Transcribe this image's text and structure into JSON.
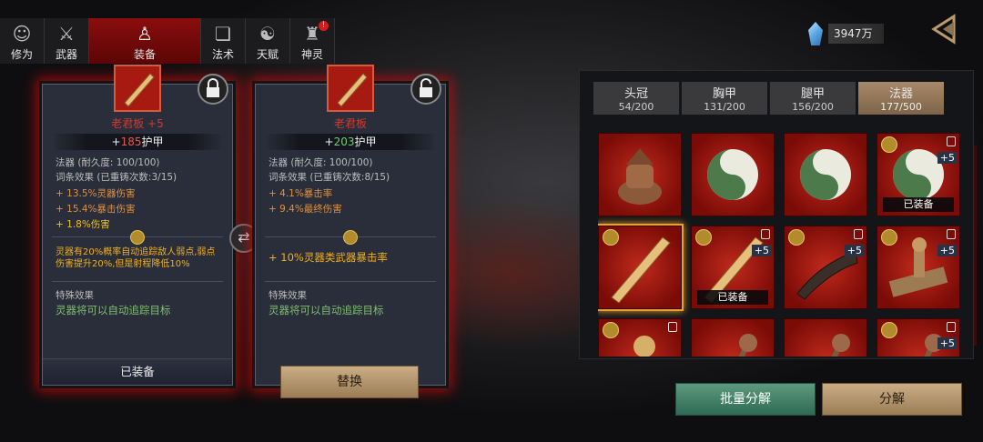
{
  "tabs": [
    {
      "label": "修为",
      "icon": "bust-icon"
    },
    {
      "label": "武器",
      "icon": "sword-icon"
    },
    {
      "label": "装备",
      "icon": "robe-icon"
    },
    {
      "label": "法术",
      "icon": "scroll-icon"
    },
    {
      "label": "天赋",
      "icon": "taiji-icon"
    },
    {
      "label": "神灵",
      "icon": "totem-icon",
      "badge": "!"
    }
  ],
  "currency": {
    "value": "3947万",
    "icon": "crystal-icon"
  },
  "left_card": {
    "name": "老君板 +5",
    "armor_value": "185",
    "armor_prefix": "+",
    "armor_suffix": "护甲",
    "durability": "法器 (耐久度: 100/100)",
    "affix_header": "词条效果 (已重铸次数:3/15)",
    "affixes": [
      "+ 13.5%灵器伤害",
      "+ 15.4%暴击伤害",
      "+ 1.8%伤害"
    ],
    "bonus": "灵器有20%概率自动追踪敌人弱点,弱点伤害提升20%,但是射程降低10%",
    "special_title": "特殊效果",
    "special_text": "灵器将可以自动追踪目标",
    "status": "已装备"
  },
  "right_card": {
    "name": "老君板",
    "armor_value": "203",
    "armor_prefix": "+",
    "armor_suffix": "护甲",
    "durability": "法器 (耐久度: 100/100)",
    "affix_header": "词条效果 (已重铸次数:8/15)",
    "affixes": [
      "+ 4.1%暴击率",
      "+ 9.4%最终伤害"
    ],
    "bonus": "+ 10%灵器类武器暴击率",
    "special_title": "特殊效果",
    "special_text": "灵器将可以自动追踪目标",
    "button": "替换"
  },
  "inventory": {
    "tabs": [
      {
        "label": "头冠",
        "count": "54/200"
      },
      {
        "label": "胸甲",
        "count": "131/200"
      },
      {
        "label": "腿甲",
        "count": "156/200"
      },
      {
        "label": "法器",
        "count": "177/500"
      }
    ],
    "equipped_label": "已装备",
    "plus_label": "+5",
    "items": [
      {
        "icon": "incense-burner-icon"
      },
      {
        "icon": "yin-yang-icon"
      },
      {
        "icon": "yin-yang-icon"
      },
      {
        "icon": "yin-yang-icon",
        "coin": true,
        "lock": true,
        "plus": true,
        "equipped": true
      },
      {
        "icon": "wooden-tablet-icon",
        "coin": true,
        "selected": true
      },
      {
        "icon": "wooden-tablet-icon",
        "coin": true,
        "lock": true,
        "plus": true,
        "equipped": true
      },
      {
        "icon": "horn-icon",
        "coin": true,
        "lock": true,
        "plus": true
      },
      {
        "icon": "seal-stamp-icon",
        "coin": true,
        "lock": true,
        "plus": true
      },
      {
        "icon": "gourd-icon",
        "coin": true,
        "lock": true
      },
      {
        "icon": "ruyi-icon"
      },
      {
        "icon": "ruyi-icon"
      },
      {
        "icon": "ruyi-icon",
        "coin": true,
        "lock": true,
        "plus": true
      }
    ]
  },
  "buttons": {
    "batch": "批量分解",
    "decompose": "分解"
  }
}
